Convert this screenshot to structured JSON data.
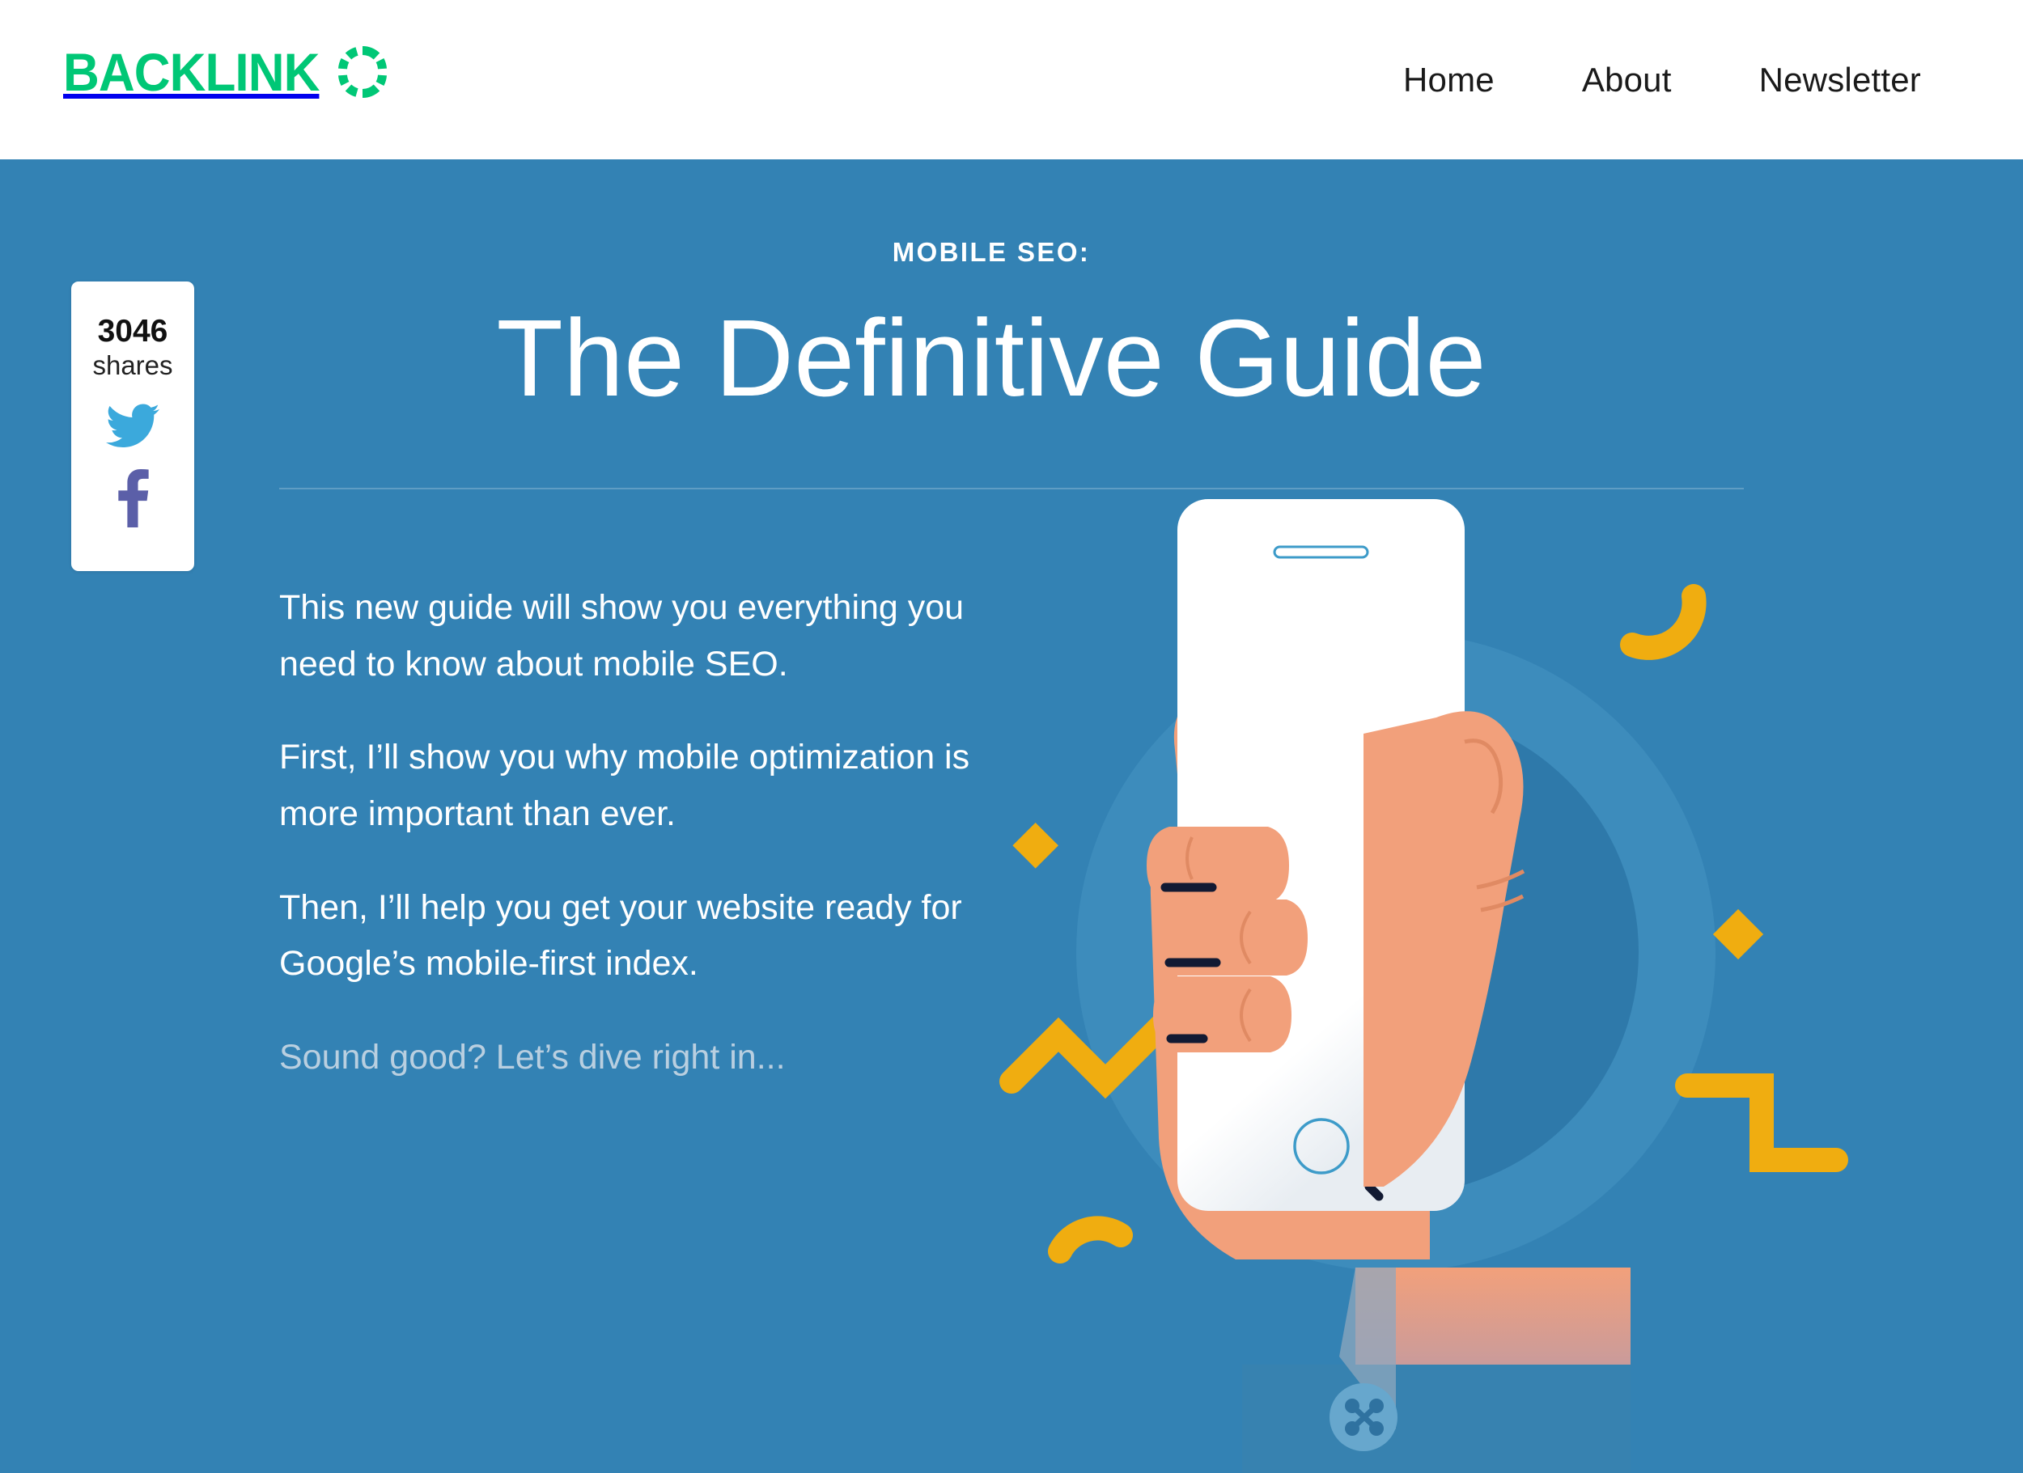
{
  "header": {
    "logo": {
      "text": "BACKLINK",
      "ring_letter": "O",
      "color": "#00C776"
    },
    "nav": [
      {
        "label": "Home"
      },
      {
        "label": "About"
      },
      {
        "label": "Newsletter"
      }
    ]
  },
  "hero": {
    "background_color": "#3382b4",
    "eyebrow": "MOBILE SEO:",
    "title": "The Definitive Guide",
    "paragraphs": [
      "This new guide will show you everything you need to know about mobile SEO.",
      "First, I’ll show you why mobile optimization is more important than ever.",
      "Then, I’ll help you get your website ready for Google’s mobile-first index."
    ],
    "closing": "Sound good? Let’s dive right in...",
    "closing_color": "#b9cfe0"
  },
  "share": {
    "count": "3046",
    "label": "shares",
    "buttons": [
      {
        "name": "twitter",
        "color": "#3BA9DC"
      },
      {
        "name": "facebook",
        "color": "#5B5FA8"
      }
    ]
  },
  "illustration": {
    "alt": "Hand holding a smartphone",
    "skin_color": "#F2A07B",
    "accent_yellow": "#F0AD10",
    "phone_color": "#FFFFFF",
    "circle_outer": "#3D8CBC",
    "circle_inner": "#2E79AA"
  }
}
